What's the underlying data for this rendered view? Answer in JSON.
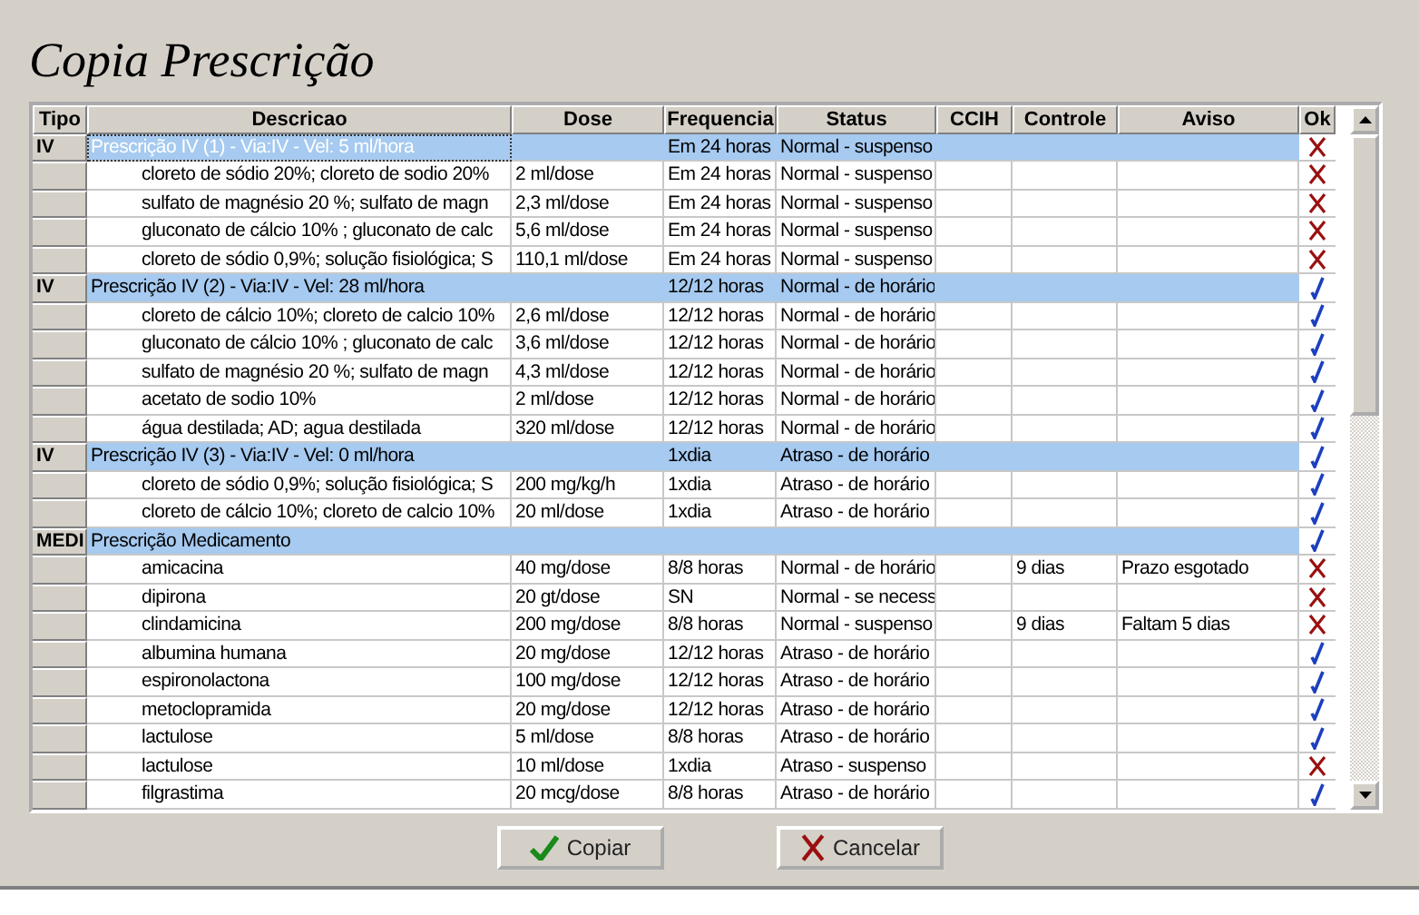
{
  "title": "Copia Prescrição",
  "columns": [
    "Tipo",
    "Descricao",
    "Dose",
    "Frequencia",
    "Status",
    "CCIH",
    "Controle",
    "Aviso",
    "Ok"
  ],
  "rows": [
    {
      "kind": "group",
      "selected": true,
      "tipo": "IV",
      "descricao": "Prescrição IV (1) - Via:IV - Vel: 5 ml/hora",
      "frequencia": "Em 24 horas",
      "status": "Normal - suspenso",
      "ok": false
    },
    {
      "kind": "item",
      "selected": false,
      "descricao": "cloreto de sódio 20%; cloreto de sodio 20%",
      "dose": "2 ml/dose",
      "frequencia": "Em 24 horas",
      "status": "Normal - suspenso",
      "ok": false
    },
    {
      "kind": "item",
      "selected": false,
      "descricao": "sulfato de magnésio 20 %; sulfato de magn",
      "dose": "2,3 ml/dose",
      "frequencia": "Em 24 horas",
      "status": "Normal - suspenso",
      "ok": false
    },
    {
      "kind": "item",
      "selected": false,
      "descricao": "gluconato de cálcio 10% ; gluconato de calc",
      "dose": "5,6 ml/dose",
      "frequencia": "Em 24 horas",
      "status": "Normal - suspenso",
      "ok": false
    },
    {
      "kind": "item",
      "selected": false,
      "descricao": "cloreto de sódio 0,9%; solução fisiológica; S",
      "dose": "110,1 ml/dose",
      "frequencia": "Em 24 horas",
      "status": "Normal - suspenso",
      "ok": false
    },
    {
      "kind": "group",
      "selected": false,
      "tipo": "IV",
      "descricao": "Prescrição IV (2) - Via:IV - Vel: 28 ml/hora",
      "frequencia": "12/12 horas",
      "status": "Normal - de horário",
      "ok": true
    },
    {
      "kind": "item",
      "selected": false,
      "descricao": "cloreto de cálcio 10%; cloreto de calcio 10%",
      "dose": "2,6 ml/dose",
      "frequencia": "12/12 horas",
      "status": "Normal - de horário",
      "ok": true
    },
    {
      "kind": "item",
      "selected": false,
      "descricao": "gluconato de cálcio 10% ; gluconato de calc",
      "dose": "3,6 ml/dose",
      "frequencia": "12/12 horas",
      "status": "Normal - de horário",
      "ok": true
    },
    {
      "kind": "item",
      "selected": false,
      "descricao": "sulfato de magnésio 20 %; sulfato de magn",
      "dose": "4,3 ml/dose",
      "frequencia": "12/12 horas",
      "status": "Normal - de horário",
      "ok": true
    },
    {
      "kind": "item",
      "selected": false,
      "descricao": "acetato de sodio 10%",
      "dose": "2 ml/dose",
      "frequencia": "12/12 horas",
      "status": "Normal - de horário",
      "ok": true
    },
    {
      "kind": "item",
      "selected": false,
      "descricao": "água destilada; AD; agua destilada",
      "dose": "320 ml/dose",
      "frequencia": "12/12 horas",
      "status": "Normal - de horário",
      "ok": true
    },
    {
      "kind": "group",
      "selected": false,
      "tipo": "IV",
      "descricao": "Prescrição IV (3) - Via:IV - Vel: 0 ml/hora",
      "frequencia": "1xdia",
      "status": "Atraso - de horário",
      "ok": true
    },
    {
      "kind": "item",
      "selected": false,
      "descricao": "cloreto de sódio 0,9%; solução fisiológica; S",
      "dose": "200 mg/kg/h",
      "frequencia": "1xdia",
      "status": "Atraso - de horário",
      "ok": true
    },
    {
      "kind": "item",
      "selected": false,
      "descricao": "cloreto de cálcio 10%; cloreto de calcio 10%",
      "dose": "20 ml/dose",
      "frequencia": "1xdia",
      "status": "Atraso - de horário",
      "ok": true
    },
    {
      "kind": "group",
      "selected": false,
      "tipo": "MEDI",
      "descricao": "Prescrição Medicamento",
      "ok": true
    },
    {
      "kind": "item",
      "selected": false,
      "descricao": "amicacina",
      "dose": "40 mg/dose",
      "frequencia": "8/8 horas",
      "status": "Normal - de horário",
      "controle": "9 dias",
      "aviso": "Prazo esgotado",
      "ok": false
    },
    {
      "kind": "item",
      "selected": false,
      "descricao": "dipirona",
      "dose": "20 gt/dose",
      "frequencia": "SN",
      "status": "Normal - se necess",
      "ok": false
    },
    {
      "kind": "item",
      "selected": false,
      "descricao": "clindamicina",
      "dose": "200 mg/dose",
      "frequencia": "8/8 horas",
      "status": "Normal - suspenso",
      "controle": "9 dias",
      "aviso": "Faltam 5 dias",
      "ok": false
    },
    {
      "kind": "item",
      "selected": false,
      "descricao": "albumina humana",
      "dose": "20 mg/dose",
      "frequencia": "12/12 horas",
      "status": "Atraso - de horário",
      "ok": true
    },
    {
      "kind": "item",
      "selected": false,
      "descricao": "espironolactona",
      "dose": "100 mg/dose",
      "frequencia": "12/12 horas",
      "status": "Atraso - de horário",
      "ok": true
    },
    {
      "kind": "item",
      "selected": false,
      "descricao": "metoclopramida",
      "dose": "20 mg/dose",
      "frequencia": "12/12 horas",
      "status": "Atraso - de horário",
      "ok": true
    },
    {
      "kind": "item",
      "selected": false,
      "descricao": "lactulose",
      "dose": "5 ml/dose",
      "frequencia": "8/8 horas",
      "status": "Atraso - de horário",
      "ok": true
    },
    {
      "kind": "item",
      "selected": false,
      "descricao": "lactulose",
      "dose": "10 ml/dose",
      "frequencia": "1xdia",
      "status": "Atraso - suspenso",
      "ok": false
    },
    {
      "kind": "item",
      "selected": false,
      "descricao": "filgrastima",
      "dose": "20 mcg/dose",
      "frequencia": "8/8 horas",
      "status": "Atraso - de horário",
      "ok": true
    }
  ],
  "buttons": [
    {
      "kind": "confirm",
      "label": "Copiar"
    },
    {
      "kind": "cancel",
      "label": "Cancelar"
    }
  ]
}
